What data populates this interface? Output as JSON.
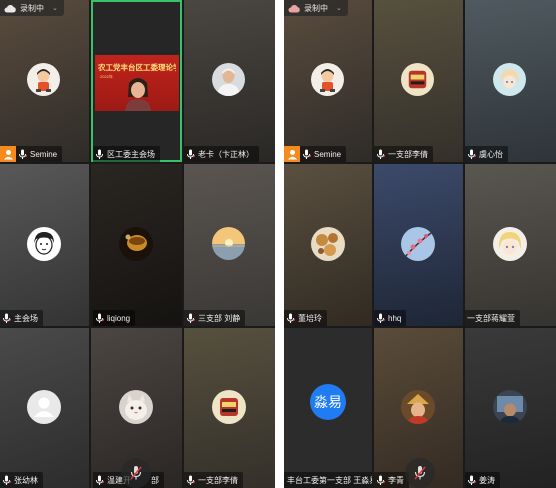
{
  "recording": {
    "label": "录制中",
    "chevron": "⌄"
  },
  "colors": {
    "accent_green": "#3ac26a",
    "host_orange": "#f58a1f",
    "text_avatar_blue": "#1f7cf2"
  },
  "left_panel": {
    "tiles": [
      {
        "name": "Semine",
        "host": true,
        "avatar": "cartoon-kid"
      },
      {
        "name": "区工委主会场",
        "active": true,
        "banner": "农工党丰台区工委理论学习",
        "banner_sub": "2022年"
      },
      {
        "name": "老卡（卞正林）",
        "avatar": "old-man-photo"
      },
      {
        "name": "主会场",
        "avatar": "sketch-boy"
      },
      {
        "name": "liqiong",
        "avatar": "teacup-photo"
      },
      {
        "name": "三支部 刘静",
        "avatar": "sunset-photo"
      },
      {
        "name": "张幼林",
        "avatar": "default-person"
      },
      {
        "name": "温建开",
        "avatar": "cat-photo",
        "name_tail": "部"
      },
      {
        "name": "一支部李倩",
        "avatar": "tin-badge"
      }
    ]
  },
  "right_panel": {
    "tiles": [
      {
        "name": "Semine",
        "host": true,
        "avatar": "cartoon-kid"
      },
      {
        "name": "一支部李倩",
        "avatar": "tin-badge"
      },
      {
        "name": "虞心怡",
        "avatar": "anime-girl"
      },
      {
        "name": "董培玲",
        "avatar": "cookies-photo"
      },
      {
        "name": "hhq",
        "avatar": "plum-blossom"
      },
      {
        "name": "一支部蒋耀萱",
        "avatar": "anime-blond"
      },
      {
        "name": "丰台工委第一支部 王淼易",
        "avatar": "text-avatar",
        "avatar_text": "淼易"
      },
      {
        "name": "李青",
        "avatar": "hat-photo"
      },
      {
        "name": "姜涛",
        "avatar": "gaming-photo"
      }
    ]
  }
}
